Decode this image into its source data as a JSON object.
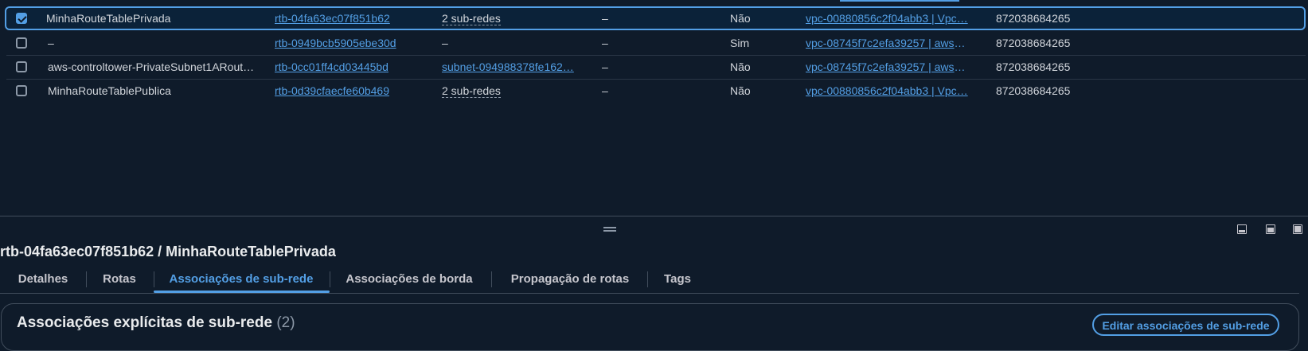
{
  "table": {
    "rows": [
      {
        "checked": true,
        "name": "MinhaRouteTablePrivada",
        "id": "rtb-04fa63ec07f851b62",
        "subnets": "2 sub-redes",
        "edge": "–",
        "main": "Não",
        "vpc": "vpc-00880856c2f04abb3 | Vpc…",
        "owner": "872038684265"
      },
      {
        "checked": false,
        "name": "–",
        "id": "rtb-0949bcb5905ebe30d",
        "subnets": "–",
        "edge": "–",
        "main": "Sim",
        "vpc": "vpc-08745f7c2efa39257 | aws-…",
        "owner": "872038684265"
      },
      {
        "checked": false,
        "name": "aws-controltower-PrivateSubnet1ARout…",
        "id": "rtb-0cc01ff4cd03445bd",
        "subnets": "subnet-094988378fe162…",
        "edge": "–",
        "main": "Não",
        "vpc": "vpc-08745f7c2efa39257 | aws-…",
        "owner": "872038684265"
      },
      {
        "checked": false,
        "name": "MinhaRouteTablePublica",
        "id": "rtb-0d39cfaecfe60b469",
        "subnets": "2 sub-redes",
        "edge": "–",
        "main": "Não",
        "vpc": "vpc-00880856c2f04abb3 | Vpc…",
        "owner": "872038684265"
      }
    ]
  },
  "details": {
    "title": "rtb-04fa63ec07f851b62 / MinhaRouteTablePrivada",
    "tabs": [
      {
        "label": "Detalhes",
        "active": false
      },
      {
        "label": "Rotas",
        "active": false
      },
      {
        "label": "Associações de sub-rede",
        "active": true
      },
      {
        "label": "Associações de borda",
        "active": false
      },
      {
        "label": "Propagação de rotas",
        "active": false
      },
      {
        "label": "Tags",
        "active": false
      }
    ]
  },
  "card": {
    "title": "Associações explícitas de sub-rede",
    "count": "(2)",
    "edit_button": "Editar associações de sub-rede"
  },
  "colors": {
    "background": "#0f1b2a",
    "accent": "#539fe5",
    "text": "#d1d5db"
  },
  "icons": [
    "resize-handle-icon",
    "panel-bottom-icon",
    "panel-split-icon",
    "panel-full-icon",
    "checkbox-icon"
  ]
}
